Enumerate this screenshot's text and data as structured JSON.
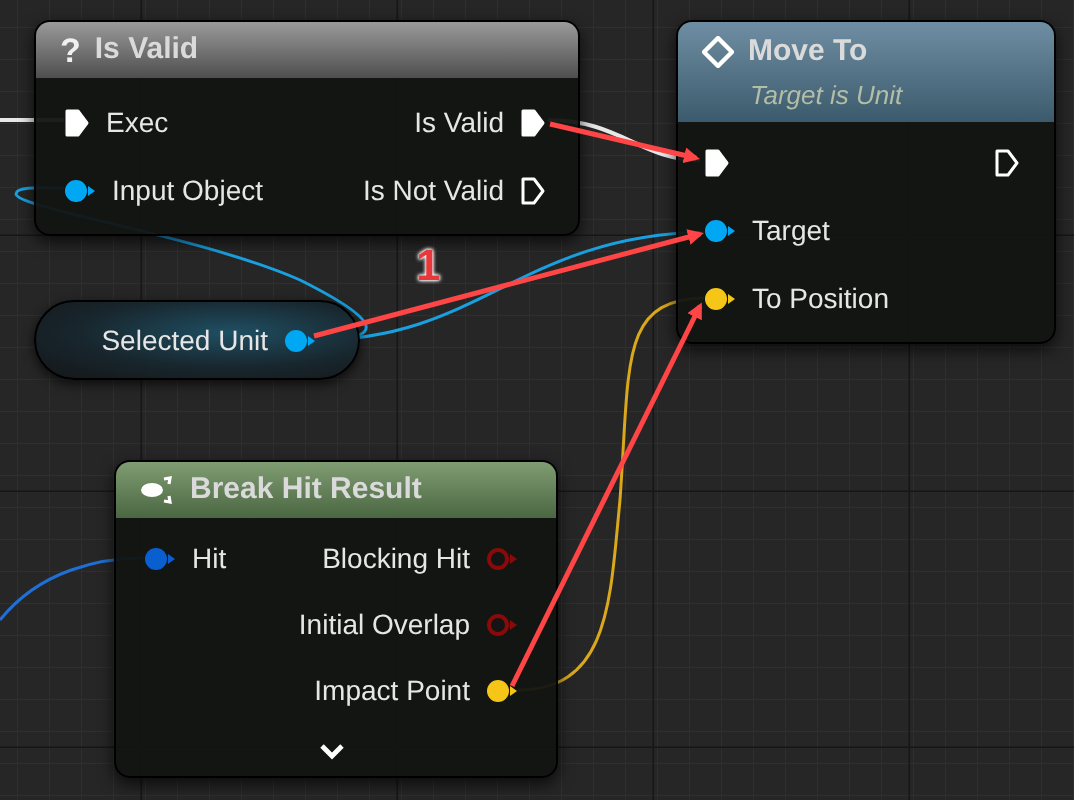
{
  "nodes": [
    {
      "kind": "macro",
      "title": "Is Valid",
      "icon": "?",
      "rows": [
        {
          "input": {
            "label": "Exec",
            "kind": "exec",
            "connected": true
          },
          "output": {
            "label": "Is Valid",
            "kind": "exec",
            "connected": true
          }
        },
        {
          "input": {
            "label": "Input Object",
            "kind": "object",
            "connected": true
          },
          "output": {
            "label": "Is Not Valid",
            "kind": "exec",
            "connected": false
          }
        }
      ]
    },
    {
      "kind": "function",
      "title": "Move To",
      "subtitle": "Target is Unit",
      "rows": [
        {
          "input": {
            "kind": "exec",
            "connected": true
          },
          "output": {
            "kind": "exec",
            "connected": false
          }
        },
        {
          "input": {
            "label": "Target",
            "kind": "object",
            "connected": true
          }
        },
        {
          "input": {
            "label": "To Position",
            "kind": "vector",
            "connected": true
          }
        }
      ]
    },
    {
      "kind": "variable",
      "rows": [
        {
          "output": {
            "label": "Selected Unit",
            "kind": "object",
            "connected": true
          }
        }
      ]
    },
    {
      "kind": "break",
      "title": "Break Hit Result",
      "collapsed": true,
      "rows": [
        {
          "input": {
            "label": "Hit",
            "kind": "struct",
            "connected": true
          },
          "output": {
            "label": "Blocking Hit",
            "kind": "bool",
            "connected": false
          }
        },
        {
          "output": {
            "label": "Initial Overlap",
            "kind": "bool",
            "connected": false
          }
        },
        {
          "output": {
            "label": "Impact Point",
            "kind": "vector",
            "connected": true
          }
        }
      ]
    }
  ],
  "annotation_label": "1"
}
